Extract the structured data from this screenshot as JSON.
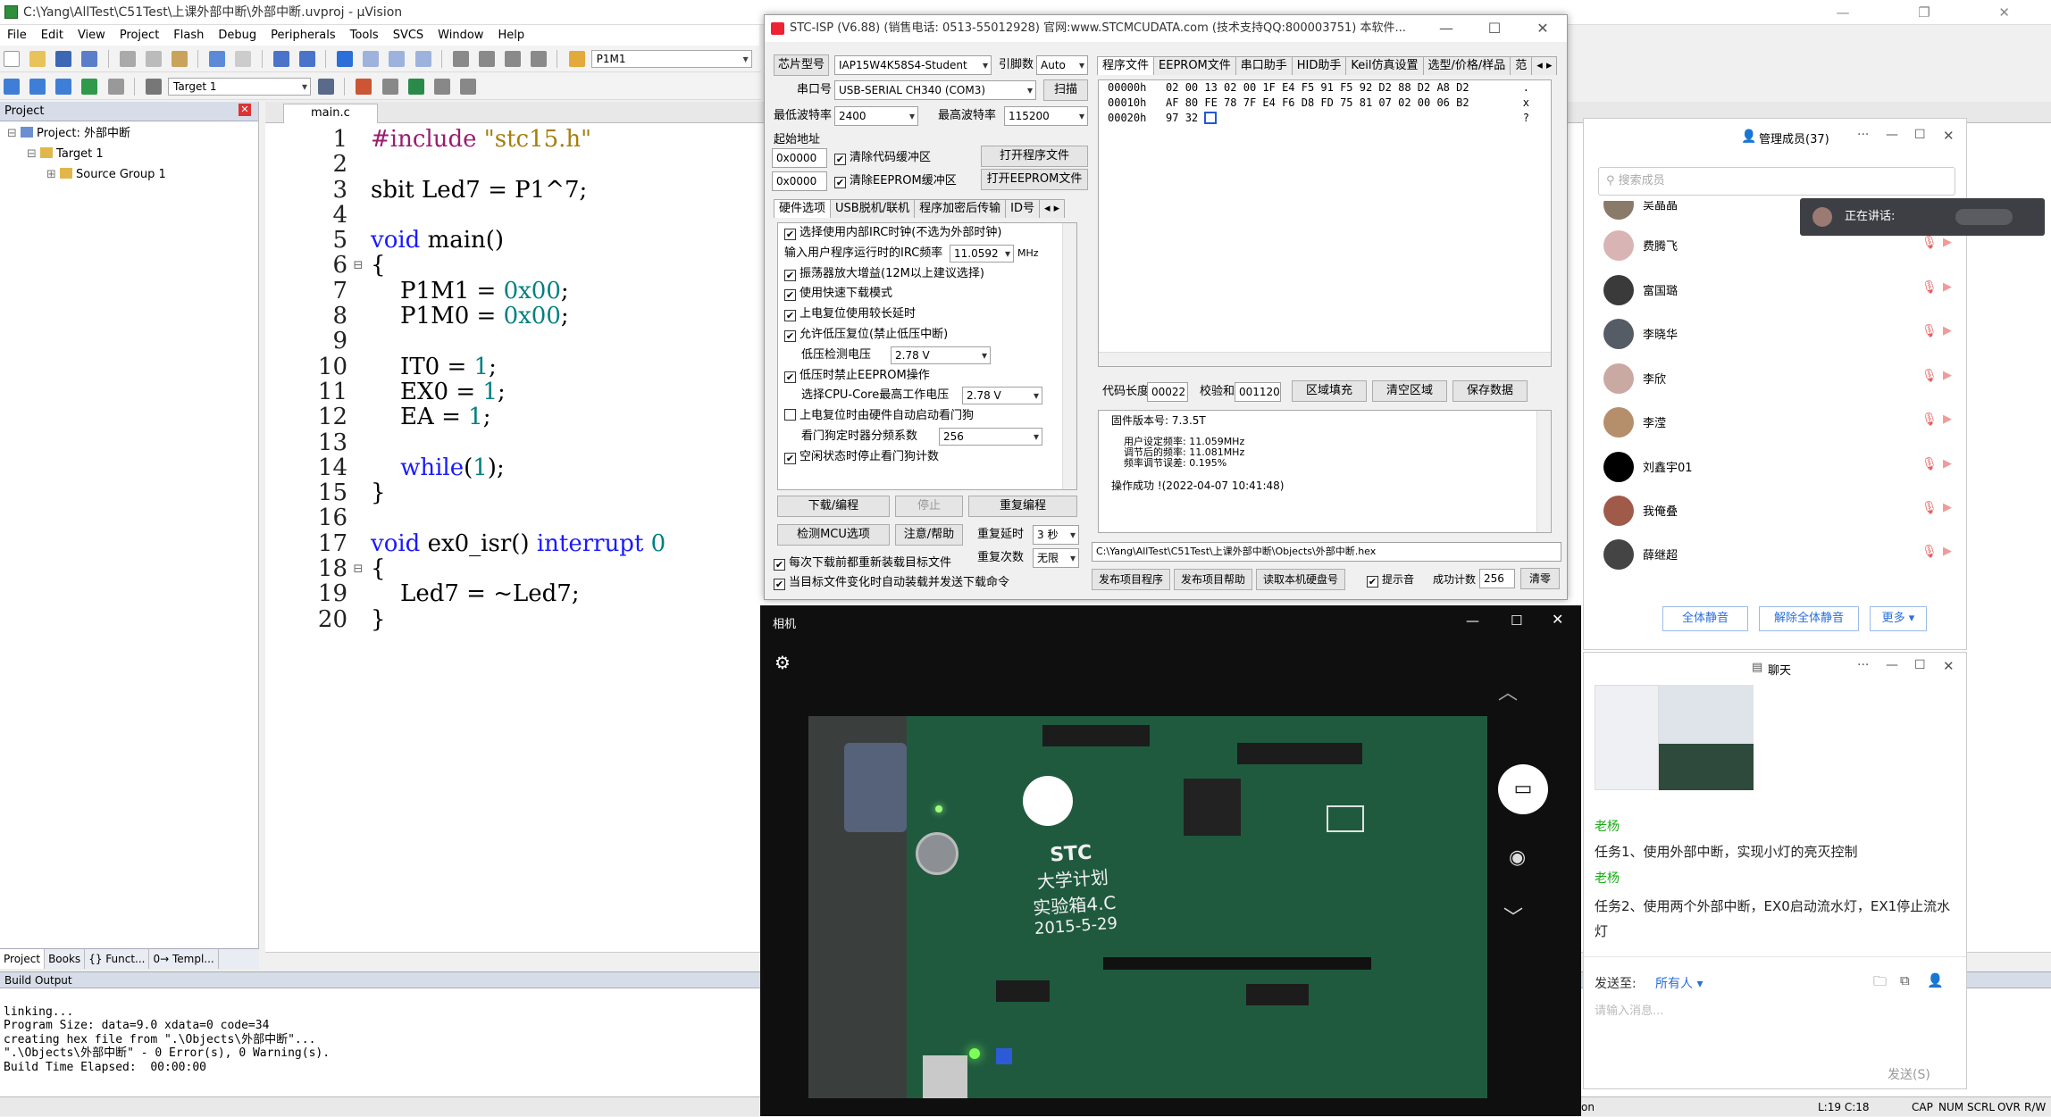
{
  "uvision": {
    "title": "C:\\Yang\\AllTest\\C51Test\\上课外部中断\\外部中断.uvproj - µVision",
    "window_controls": "— ❐ ✕",
    "menu": [
      "File",
      "Edit",
      "View",
      "Project",
      "Flash",
      "Debug",
      "Peripherals",
      "Tools",
      "SVCS",
      "Window",
      "Help"
    ],
    "toolbar_combo": "P1M1",
    "target_combo": "Target 1",
    "project_panel": {
      "header": "Project",
      "tree": [
        "Project: 外部中断",
        "Target 1",
        "Source Group 1"
      ],
      "tabs": [
        "Project",
        "Books",
        "{} Funct...",
        "0→ Templ..."
      ]
    },
    "editor": {
      "tab": "main.c",
      "lines": [
        {
          "n": "1",
          "code": "#include \"stc15.h\""
        },
        {
          "n": "2",
          "code": ""
        },
        {
          "n": "3",
          "code": "sbit Led7 = P1^7;"
        },
        {
          "n": "4",
          "code": ""
        },
        {
          "n": "5",
          "code": "void main()"
        },
        {
          "n": "6",
          "code": "{"
        },
        {
          "n": "7",
          "code": "    P1M1 = 0x00;"
        },
        {
          "n": "8",
          "code": "    P1M0 = 0x00;"
        },
        {
          "n": "9",
          "code": ""
        },
        {
          "n": "10",
          "code": "    IT0 = 1;"
        },
        {
          "n": "11",
          "code": "    EX0 = 1;"
        },
        {
          "n": "12",
          "code": "    EA = 1;"
        },
        {
          "n": "13",
          "code": ""
        },
        {
          "n": "14",
          "code": "    while(1);"
        },
        {
          "n": "15",
          "code": "}"
        },
        {
          "n": "16",
          "code": ""
        },
        {
          "n": "17",
          "code": "void ex0_isr() interrupt 0"
        },
        {
          "n": "18",
          "code": "{"
        },
        {
          "n": "19",
          "code": "    Led7 = ~Led7;"
        },
        {
          "n": "20",
          "code": "}"
        }
      ]
    },
    "build_output": {
      "header": "Build Output",
      "lines": [
        "linking...",
        "Program Size: data=9.0 xdata=0 code=34",
        "creating hex file from \".\\Objects\\外部中断\"...",
        "\".\\Objects\\外部中断\" - 0 Error(s), 0 Warning(s).",
        "Build Time Elapsed:  00:00:00"
      ]
    },
    "status": {
      "left": "on",
      "pos": "L:19 C:18",
      "caps": "CAP",
      "num": "NUM",
      "scrl": "SCRL",
      "ovr": "OVR",
      "rw": "R/W"
    }
  },
  "isp": {
    "title": "STC-ISP (V6.88) (销售电话: 0513-55012928) 官网:www.STCMCUDATA.com (技术支持QQ:800003751) 本软件...",
    "chip_label": "芯片型号",
    "chip_value": "IAP15W4K58S4-Student",
    "pin_label": "引脚数",
    "pin_value": "Auto",
    "port_label": "串口号",
    "port_value": "USB-SERIAL CH340 (COM3)",
    "scan_btn": "扫描",
    "min_baud_label": "最低波特率",
    "min_baud": "2400",
    "max_baud_label": "最高波特率",
    "max_baud": "115200",
    "start_addr_label": "起始地址",
    "addr1": "0x0000",
    "clear_code": "清除代码缓冲区",
    "open_prog": "打开程序文件",
    "addr2": "0x0000",
    "clear_eeprom": "清除EEPROM缓冲区",
    "open_eeprom": "打开EEPROM文件",
    "left_tabs": [
      "硬件选项",
      "USB脱机/联机",
      "程序加密后传输",
      "ID号"
    ],
    "hw_options": [
      {
        "checked": "✔",
        "text": "选择使用内部IRC时钟(不选为外部时钟)"
      },
      {
        "checked": "",
        "text": "输入用户程序运行时的IRC频率"
      },
      {
        "checked": "✔",
        "text": "振荡器放大增益(12M以上建议选择)"
      },
      {
        "checked": "✔",
        "text": "使用快速下载模式"
      },
      {
        "checked": "✔",
        "text": "上电复位使用较长延时"
      },
      {
        "checked": "✔",
        "text": "允许低压复位(禁止低压中断)"
      },
      {
        "checked": "",
        "text": "低压检测电压"
      },
      {
        "checked": "✔",
        "text": "低压时禁止EEPROM操作"
      },
      {
        "checked": "",
        "text": "选择CPU-Core最高工作电压"
      },
      {
        "checked": "",
        "text": "上电复位时由硬件自动启动看门狗"
      },
      {
        "checked": "",
        "text": "看门狗定时器分频系数"
      },
      {
        "checked": "✔",
        "text": "空闲状态时停止看门狗计数"
      }
    ],
    "irc_freq": "11.0592",
    "irc_unit": "MHz",
    "lvd_voltage": "2.78 V",
    "cpu_voltage": "2.78 V",
    "wdt_div": "256",
    "download_btn": "下载/编程",
    "stop_btn": "停止",
    "reprogram_btn": "重复编程",
    "check_btn": "检测MCU选项",
    "help_btn": "注意/帮助",
    "repeat_delay_label": "重复延时",
    "repeat_delay": "3 秒",
    "repeat_count_label": "重复次数",
    "repeat_count": "无限",
    "reload_each": "每次下载前都重新装载目标文件",
    "auto_load": "当目标文件变化时自动装载并发送下载命令",
    "right_tabs": [
      "程序文件",
      "EEPROM文件",
      "串口助手",
      "HID助手",
      "Keil仿真设置",
      "选型/价格/样品",
      "范"
    ],
    "hex_rows": [
      "00000h   02 00 13 02 00 1F E4 F5 91 F5 92 D2 88 D2 A8 D2",
      "00010h   AF 80 FE 78 7F E4 F6 D8 FD 75 81 07 02 00 06 B2",
      "00020h   97 32"
    ],
    "hex_ascii": [
      ".",
      "x",
      "?"
    ],
    "code_len_label": "代码长度",
    "code_len": "00022",
    "checksum_label": "校验和",
    "checksum": "001120",
    "fill_btn": "区域填充",
    "clear_btn": "清空区域",
    "save_btn": "保存数据",
    "fw_version": "固件版本号: 7.3.5T",
    "user_freq": "用户设定频率: 11.059MHz",
    "tuned_freq": "调节后的频率: 11.081MHz",
    "freq_err": "频率调节误差: 0.195%",
    "op_result": "操作成功 !(2022-04-07 10:41:48)",
    "hex_path": "C:\\Yang\\AllTest\\C51Test\\上课外部中断\\Objects\\外部中断.hex",
    "publish_prog": "发布项目程序",
    "publish_help": "发布项目帮助",
    "read_disk": "读取本机硬盘号",
    "hint_label": "提示音",
    "success_label": "成功计数",
    "success_count": "256",
    "clear_count": "清零"
  },
  "members": {
    "header": "管理成员(37)",
    "search_placeholder": "搜索成员",
    "people": [
      "吴晶晶",
      "费腾飞",
      "富国璐",
      "李晓华",
      "李欣",
      "李滢",
      "刘鑫宇01",
      "我俺叠",
      "薛继超"
    ],
    "mute_all": "全体静音",
    "unmute_all": "解除全体静音",
    "more": "更多 ▾",
    "speaking": "正在讲话:"
  },
  "chat": {
    "header": "聊天",
    "messages": [
      {
        "sender": "老杨",
        "text": "任务1、使用外部中断，实现小灯的亮灭控制"
      },
      {
        "sender": "老杨",
        "text": "任务2、使用两个外部中断，EX0启动流水灯，EX1停止流水灯"
      }
    ],
    "send_to_label": "发送至:",
    "send_to_value": "所有人 ▾",
    "input_placeholder": "请输入消息...",
    "send_btn": "发送(S)"
  },
  "camera": {
    "title": "相机",
    "board_text": [
      "STC",
      "大学计划",
      "实验箱4.C",
      "2015-5-29"
    ]
  },
  "colors": {
    "keyword": "#1a1aff",
    "preproc": "#9b1c6e",
    "number": "#008080",
    "string": "#a67f0c",
    "chat_sender": "#1aad19",
    "link": "#2a6fdb"
  }
}
